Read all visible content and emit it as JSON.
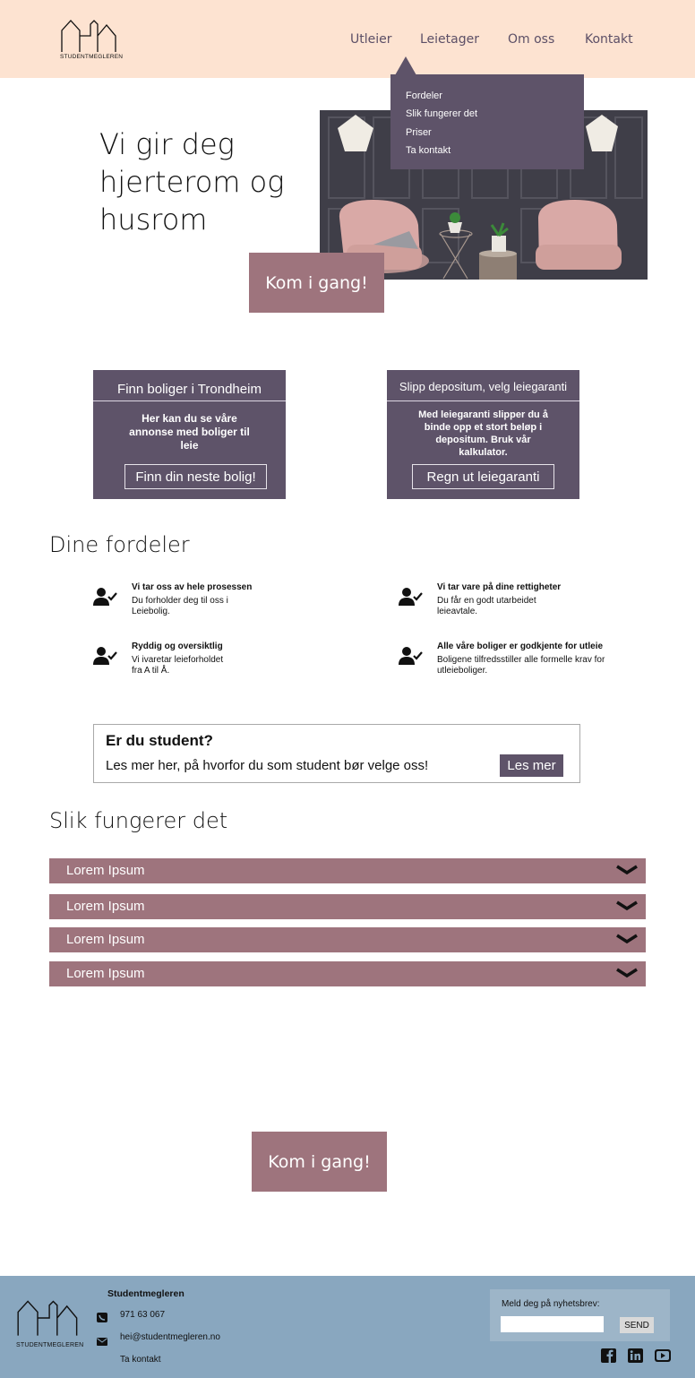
{
  "header": {
    "logo_text": "STUDENTMEGLEREN",
    "nav": [
      "Utleier",
      "Leietager",
      "Om oss",
      "Kontakt"
    ],
    "dropdown": [
      "Fordeler",
      "Slik fungerer det",
      "Priser",
      "Ta kontakt"
    ]
  },
  "hero": {
    "title_lines": [
      "Vi gir deg",
      "hjerterom og",
      "husrom"
    ],
    "cta": "Kom i gang!"
  },
  "cards": [
    {
      "title": "Finn boliger i Trondheim",
      "body": "Her kan du se våre annonse med boliger til leie",
      "button": "Finn din neste bolig!"
    },
    {
      "title": "Slipp depositum, velg leiegaranti",
      "body": "Med leiegaranti slipper du å binde opp et stort beløp i depositum. Bruk vår kalkulator.",
      "button": "Regn ut leiegaranti"
    }
  ],
  "benefits": {
    "title": "Dine fordeler",
    "items": [
      {
        "title": "Vi tar oss av hele prosessen",
        "text": "Du forholder deg til oss i Leiebolig."
      },
      {
        "title": "Vi tar vare på dine rettigheter",
        "text": "Du får en godt utarbeidet leieavtale."
      },
      {
        "title": "Ryddig og oversiktlig",
        "text": "Vi ivaretar leieforholdet fra A til Å."
      },
      {
        "title": "Alle våre boliger er godkjente for utleie",
        "text": "Boligene tilfredsstiller alle formelle krav for utleieboliger."
      }
    ],
    "icon": "user-check-icon"
  },
  "student": {
    "title": "Er du student?",
    "text": "Les mer her, på hvorfor du som student bør velge oss!",
    "button": "Les mer"
  },
  "how": {
    "title": "Slik fungerer det",
    "items": [
      "Lorem Ipsum",
      "Lorem Ipsum",
      "Lorem Ipsum",
      "Lorem Ipsum"
    ]
  },
  "bottom_cta": "Kom i gang!",
  "footer": {
    "company": "Studentmegleren",
    "phone": "971 63 067",
    "email": "hei@studentmegleren.no",
    "contact": "Ta kontakt",
    "logo_text": "STUDENTMEGLEREN",
    "newsletter_label": "Meld deg på nyhetsbrev:",
    "send": "SEND",
    "social": [
      "facebook-icon",
      "linkedin-icon",
      "youtube-icon"
    ]
  },
  "colors": {
    "header_bg": "#fde3d1",
    "accent_purple": "#5e5369",
    "accent_mauve": "#9e747d",
    "footer_bg": "#89a7bf"
  }
}
